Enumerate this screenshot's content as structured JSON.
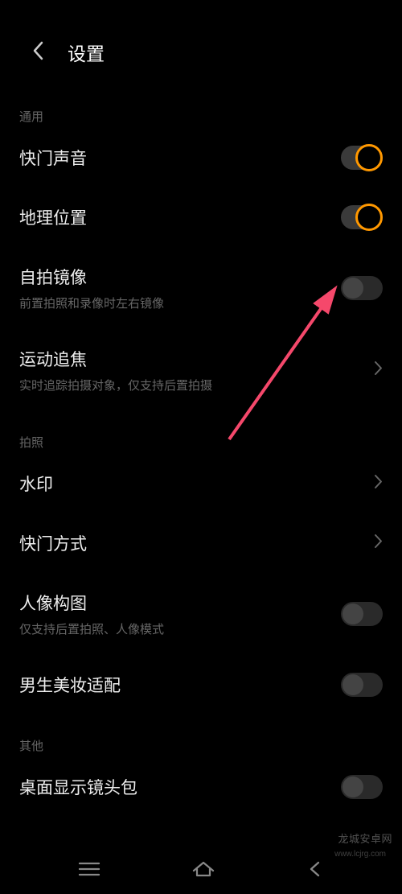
{
  "header": {
    "title": "设置"
  },
  "sections": {
    "general": {
      "header": "通用",
      "shutter_sound": {
        "label": "快门声音"
      },
      "geolocation": {
        "label": "地理位置"
      },
      "selfie_mirror": {
        "label": "自拍镜像",
        "sub": "前置拍照和录像时左右镜像"
      },
      "motion_track": {
        "label": "运动追焦",
        "sub": "实时追踪拍摄对象，仅支持后置拍摄"
      }
    },
    "photo": {
      "header": "拍照",
      "watermark": {
        "label": "水印"
      },
      "shutter_mode": {
        "label": "快门方式"
      },
      "portrait_composition": {
        "label": "人像构图",
        "sub": "仅支持后置拍照、人像模式"
      },
      "male_beauty": {
        "label": "男生美妆适配"
      }
    },
    "other": {
      "header": "其他",
      "desktop_lens": {
        "label": "桌面显示镜头包"
      }
    }
  },
  "watermark_text": "龙城安卓网",
  "watermark_url": "www.lcjrg.com"
}
